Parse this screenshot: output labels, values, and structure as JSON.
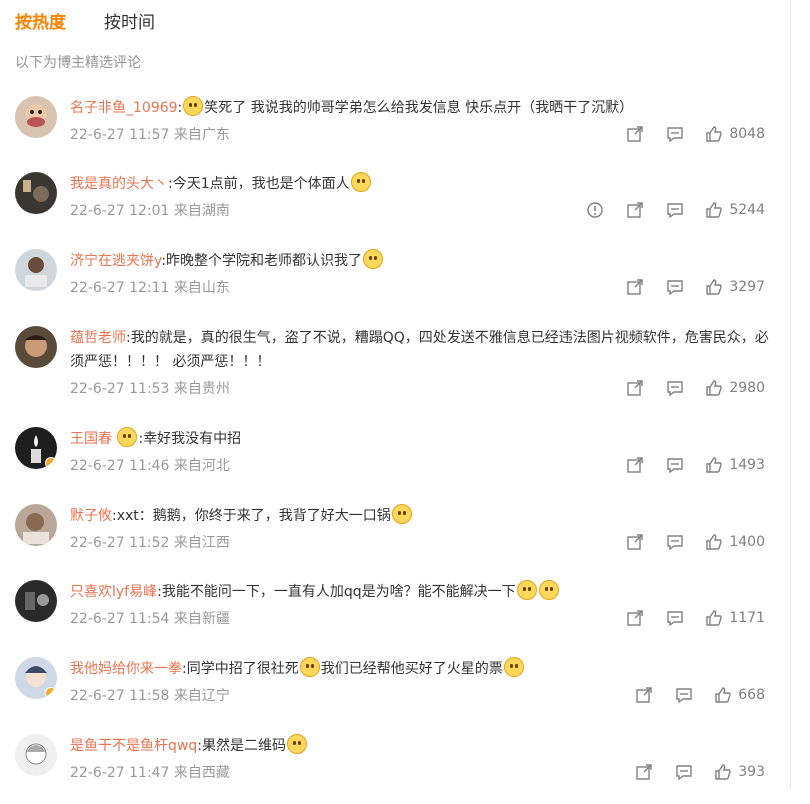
{
  "tabs": {
    "hot": "按热度",
    "time": "按时间"
  },
  "subtitle": "以下为博主精选评论",
  "comments": [
    {
      "name": "名子非鱼_10969",
      "text": "笑死了 我说我的帅哥学弟怎么给我发信息 快乐点开（我晒干了沉默）",
      "time": "22-6-27 11:57",
      "location": "来自广东",
      "likes": "8048"
    },
    {
      "name": "我是真的头大丶",
      "text": ":今天1点前，我也是个体面人",
      "time": "22-6-27 12:01",
      "location": "来自湖南",
      "likes": "5244"
    },
    {
      "name": "济宁在逃夹饼y",
      "text": ":昨晚整个学院和老师都认识我了",
      "time": "22-6-27 12:11",
      "location": "来自山东",
      "likes": "3297"
    },
    {
      "name": "蕴哲老师",
      "text": ":我的就是，真的很生气，盗了不说，糟蹋QQ，四处发送不雅信息已经违法图片视频软件，危害民众，必须严惩！！！！ 必须严惩！！！",
      "time": "22-6-27 11:53",
      "location": "来自贵州",
      "likes": "2980"
    },
    {
      "name": "王国春",
      "text": ":幸好我没有中招",
      "time": "22-6-27 11:46",
      "location": "来自河北",
      "likes": "1493"
    },
    {
      "name": "默子攸",
      "text": ":xxt：鹅鹅，你终于来了，我背了好大一口锅",
      "time": "22-6-27 11:52",
      "location": "来自江西",
      "likes": "1400"
    },
    {
      "name": "只喜欢lyf易峰",
      "text": ":我能不能问一下，一直有人加qq是为啥？能不能解决一下",
      "time": "22-6-27 11:54",
      "location": "来自新疆",
      "likes": "1171"
    },
    {
      "name": "我他妈给你来一拳",
      "text": ":同学中招了很社死",
      "text2": "我们已经帮他买好了火星的票",
      "time": "22-6-27 11:58",
      "location": "来自辽宁",
      "likes": "668"
    },
    {
      "name": "是鱼干不是鱼杆qwq",
      "text": ":果然是二维码",
      "time": "22-6-27 11:47",
      "location": "来自西藏",
      "likes": "393"
    }
  ],
  "colors": {
    "accent": "#ff8200",
    "name": "#eb7350",
    "meta": "#999999"
  },
  "icons": {
    "share": "share-icon",
    "comment": "comment-icon",
    "like": "thumbs-up-icon",
    "report": "report-icon"
  }
}
